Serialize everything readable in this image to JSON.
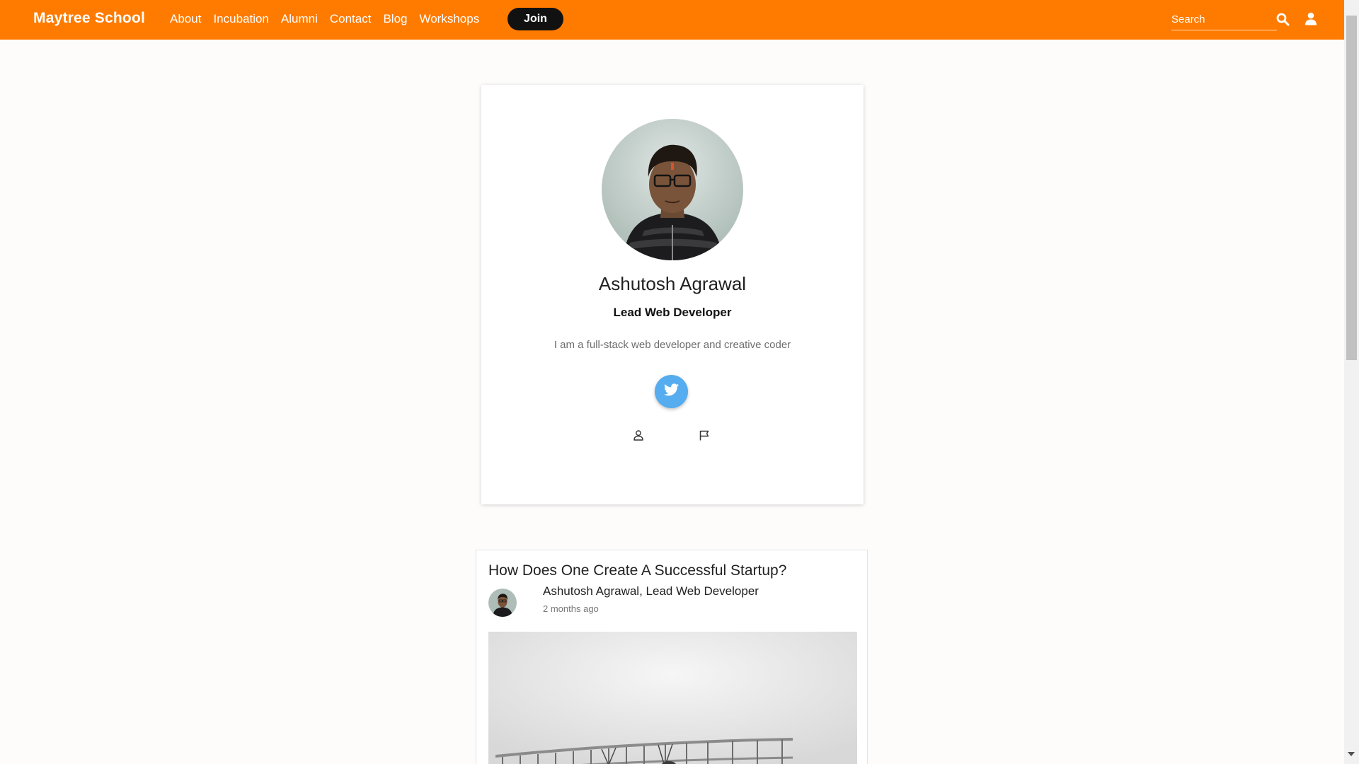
{
  "nav": {
    "brand": "Maytree School",
    "links": [
      "About",
      "Incubation",
      "Alumni",
      "Contact",
      "Blog",
      "Workshops"
    ],
    "join_label": "Join",
    "search_placeholder": "Search"
  },
  "profile": {
    "name": "Ashutosh Agrawal",
    "role": "Lead Web Developer",
    "bio": "I am a full-stack web developer and creative coder"
  },
  "post": {
    "title": "How Does One Create A Successful Startup?",
    "author": "Ashutosh Agrawal, Lead Web Developer",
    "time": "2 months ago"
  },
  "icons": {
    "search": "search-icon",
    "user": "user-icon",
    "twitter": "twitter-icon",
    "profile_link": "person-outline-icon",
    "report": "flag-icon"
  },
  "colors": {
    "navbar": "#ff7b00",
    "join_button": "#111111",
    "twitter": "#55acee",
    "page_background": "#fdfcfb"
  }
}
